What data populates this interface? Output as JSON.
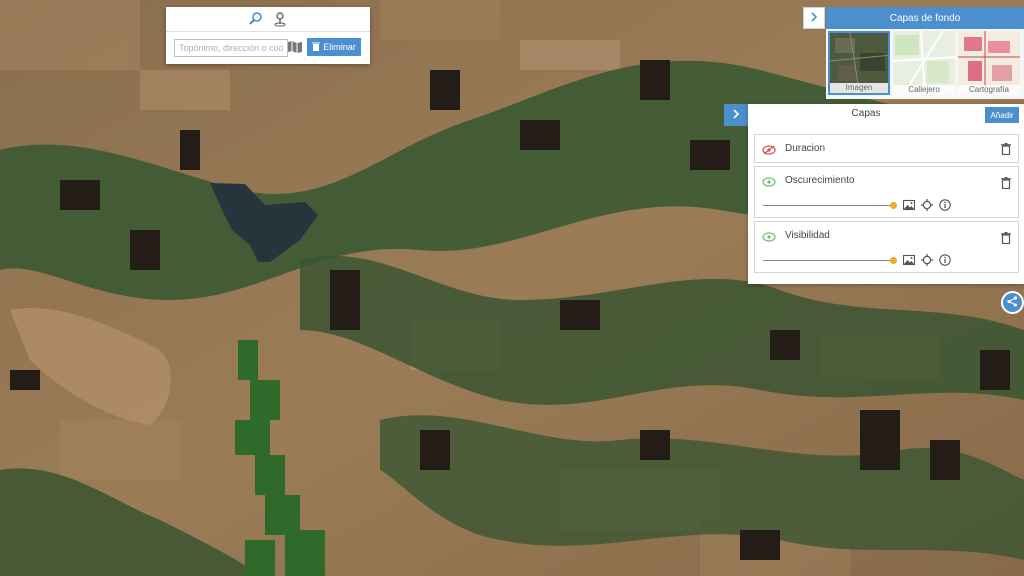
{
  "search": {
    "placeholder": "Topónimo, dirección o coo",
    "delete_label": "Eliminar",
    "tabs": [
      "search-tab",
      "location-pin-tab"
    ]
  },
  "basemaps": {
    "title": "Capas de fondo",
    "options": [
      {
        "label": "Imagen",
        "selected": true
      },
      {
        "label": "Callejero",
        "selected": false
      },
      {
        "label": "Cartografía",
        "selected": false
      }
    ]
  },
  "layers": {
    "title": "Capas",
    "add_label": "Añadir",
    "items": [
      {
        "name": "Duracion",
        "visible": false
      },
      {
        "name": "Oscurecimiento",
        "visible": true,
        "opacity": 1.0
      },
      {
        "name": "Visibilidad",
        "visible": true,
        "opacity": 1.0
      }
    ]
  },
  "colors": {
    "accent": "#4b8fce",
    "slider_thumb": "#f0a830",
    "eye_visible": "#6cbf6c",
    "eye_hidden": "#d9534f"
  },
  "icons": [
    "search-icon",
    "pin-icon",
    "map-icon",
    "trash-icon",
    "eye-icon",
    "image-icon",
    "crosshair-icon",
    "info-icon",
    "chevron-right-icon",
    "share-icon"
  ]
}
